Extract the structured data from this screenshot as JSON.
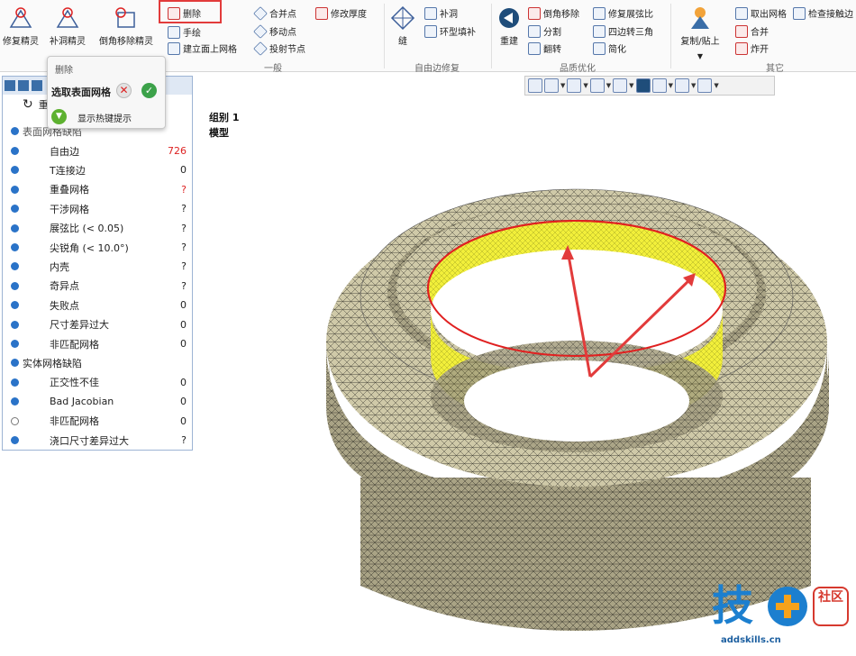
{
  "ribbon": {
    "big_buttons": [
      "修复精灵",
      "补洞精灵",
      "倒角移除精灵",
      "缝",
      "重建",
      "复制/贴上"
    ],
    "col_a": [
      "删除",
      "手绘",
      "建立面上网格"
    ],
    "col_b": [
      "合并点",
      "移动点",
      "投射节点"
    ],
    "col_c": [
      "修改厚度"
    ],
    "col_d": [
      "补洞",
      "环型填补"
    ],
    "col_e": [
      "倒角移除",
      "分割",
      "翻转"
    ],
    "col_f": [
      "修复展弦比",
      "四边转三角",
      "简化"
    ],
    "col_g": [
      "取出网格",
      "合并",
      "炸开"
    ],
    "col_h": [
      "检查接触边"
    ],
    "groups": [
      "一般",
      "自由边修复",
      "品质优化",
      "其它"
    ]
  },
  "popup": {
    "title": "删除",
    "select_label": "选取表面网格",
    "cancel_glyph": "✕",
    "ok_glyph": "✓",
    "hint_label": "显示热键提示"
  },
  "panel": {
    "reset_label": "重置",
    "surface_group": "表面网格缺陷",
    "solid_group": "实体网格缺陷",
    "rows": [
      {
        "label": "自由边",
        "value": "726"
      },
      {
        "label": "T连接边",
        "value": "0"
      },
      {
        "label": "重叠网格",
        "value": "?"
      },
      {
        "label": "干涉网格",
        "value": "?"
      },
      {
        "label": "展弦比 (< 0.05)",
        "value": "?"
      },
      {
        "label": "尖锐角 (< 10.0°)",
        "value": "?"
      },
      {
        "label": "内壳",
        "value": "?"
      },
      {
        "label": "奇异点",
        "value": "?"
      },
      {
        "label": "失败点",
        "value": "0"
      },
      {
        "label": "尺寸差异过大",
        "value": "0"
      },
      {
        "label": "非匹配网格",
        "value": "0"
      }
    ],
    "solid_rows": [
      {
        "label": "正交性不佳",
        "value": "0"
      },
      {
        "label": "Bad Jacobian",
        "value": "0"
      },
      {
        "label": "非匹配网格",
        "value": "0"
      },
      {
        "label": "浇口尺寸差异过大",
        "value": "?"
      }
    ]
  },
  "viewport": {
    "group_label": "组别 1",
    "model_label": "模型"
  },
  "brand": {
    "char": "技",
    "badge": "社区",
    "url": "addskills.cn"
  },
  "colors": {
    "accent": "#2a73c8",
    "highlight_red": "#e23b3b",
    "mesh_fill": "#cfc9a8",
    "selected_yellow": "#f2ef3a"
  }
}
